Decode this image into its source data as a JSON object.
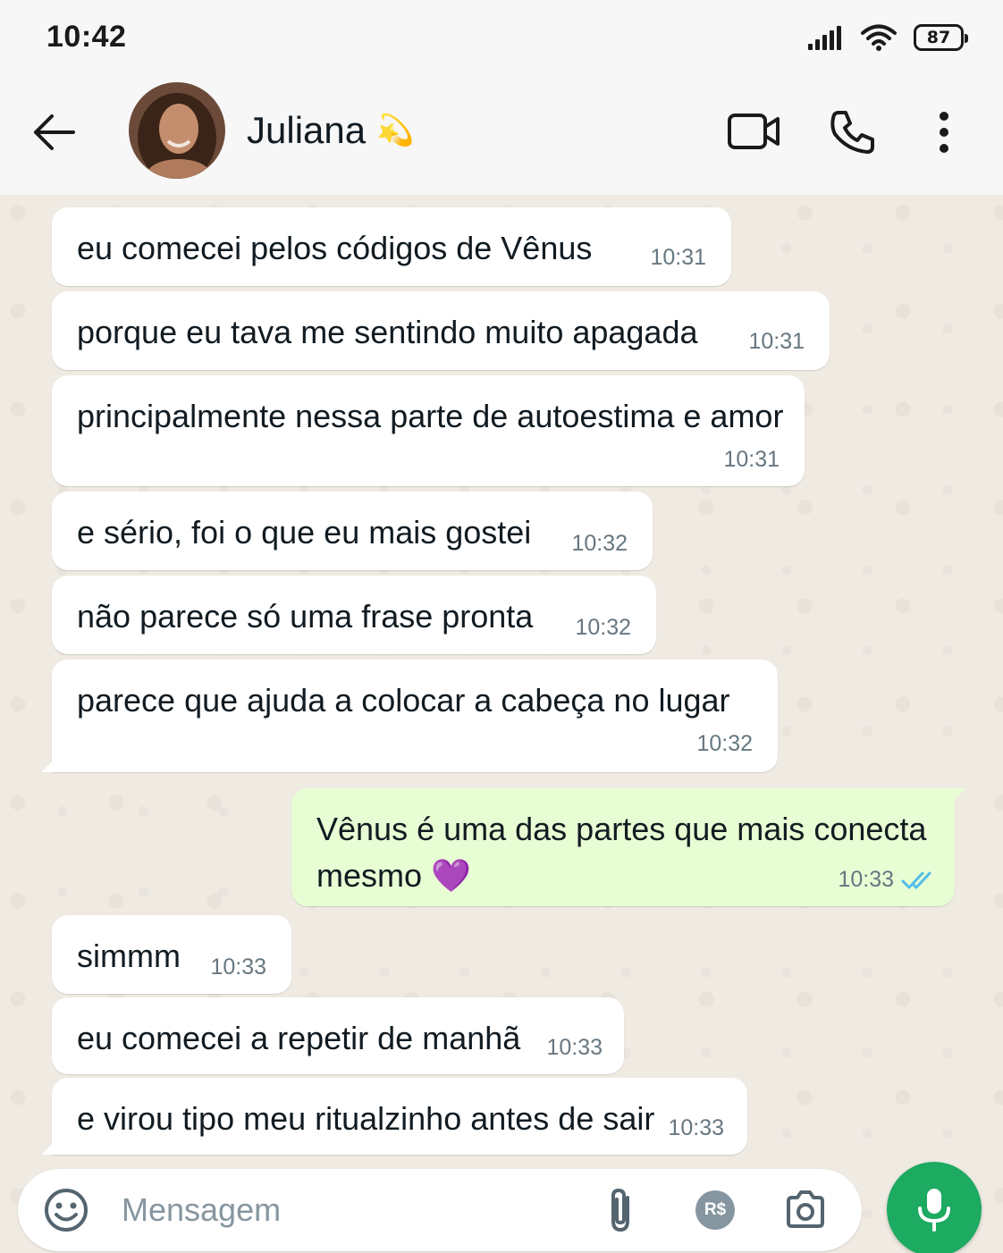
{
  "status_bar": {
    "time": "10:42",
    "battery": "87",
    "icons": [
      "signal-icon",
      "wifi-icon",
      "battery-icon"
    ]
  },
  "header": {
    "contact_name": "Juliana",
    "contact_emoji": "💫",
    "icons": [
      "back-arrow-icon",
      "video-call-icon",
      "phone-icon",
      "more-options-icon"
    ]
  },
  "messages": [
    {
      "direction": "in",
      "text": "eu comecei pelos códigos de Vênus",
      "time": "10:31"
    },
    {
      "direction": "in",
      "text": "porque eu tava me sentindo muito apagada",
      "time": "10:31"
    },
    {
      "direction": "in",
      "text": "principalmente nessa parte de autoestima e amor",
      "time": "10:31"
    },
    {
      "direction": "in",
      "text": "e sério, foi o que eu mais gostei",
      "time": "10:32"
    },
    {
      "direction": "in",
      "text": "não parece só uma frase pronta",
      "time": "10:32"
    },
    {
      "direction": "in",
      "text": "parece que ajuda a colocar a cabeça no lugar",
      "time": "10:32"
    },
    {
      "direction": "out",
      "text_line1": "Vênus é uma das partes que mais conecta",
      "text_line2": "mesmo",
      "emoji": "💜",
      "time": "10:33",
      "status": "read"
    },
    {
      "direction": "in",
      "text": "simmm",
      "time": "10:33"
    },
    {
      "direction": "in",
      "text": "eu comecei a repetir de manhã",
      "time": "10:33"
    },
    {
      "direction": "in",
      "text": "e virou tipo meu ritualzinho antes de sair",
      "time": "10:33"
    }
  ],
  "input_bar": {
    "placeholder": "Mensagem",
    "payment_label": "R$",
    "icons": [
      "emoji-icon",
      "attach-icon",
      "payment-icon",
      "camera-icon",
      "mic-icon"
    ]
  },
  "colors": {
    "chat_background": "#efeae2",
    "incoming_bubble": "#ffffff",
    "outgoing_bubble": "#e7fdd3",
    "accent_green": "#1daa61",
    "read_tick": "#53bdeb"
  }
}
